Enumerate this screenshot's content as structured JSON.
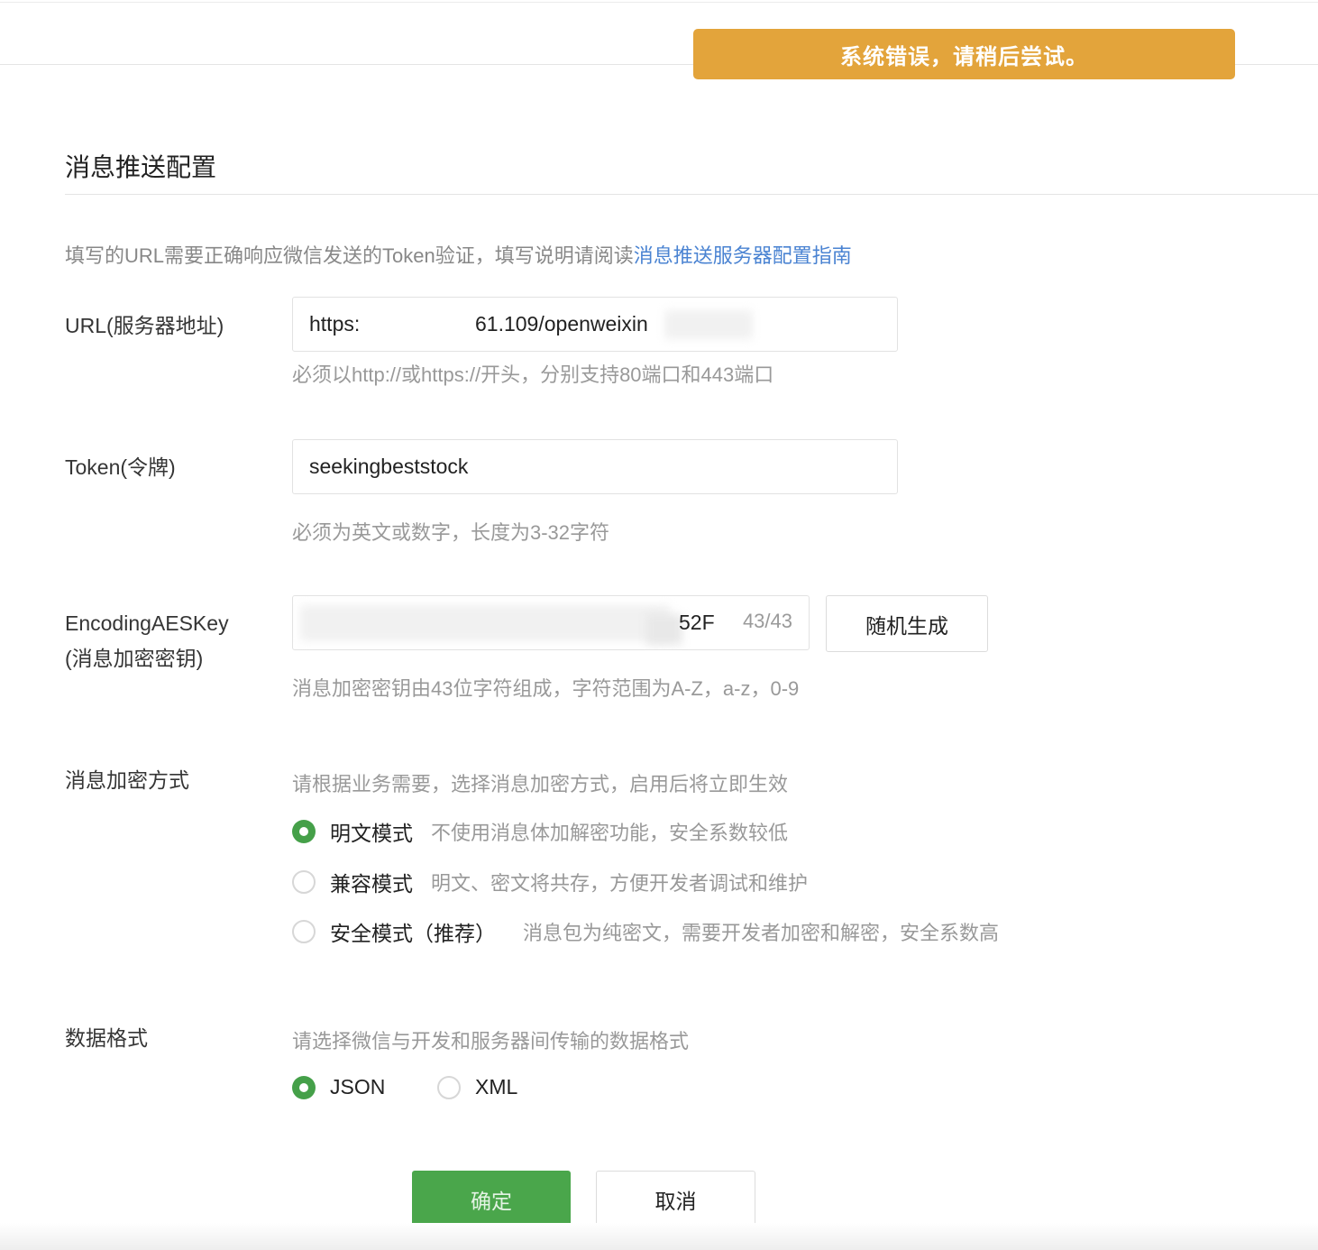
{
  "toast": {
    "message": "系统错误，请稍后尝试。",
    "color": "#e3a43b"
  },
  "section": {
    "title": "消息推送配置"
  },
  "intro": {
    "text": "填写的URL需要正确响应微信发送的Token验证，填写说明请阅读",
    "link": "消息推送服务器配置指南"
  },
  "url": {
    "label": "URL(服务器地址)",
    "value_start": "https:",
    "value_end": "61.109/openweixin",
    "hint": "必须以http://或https://开头，分别支持80端口和443端口"
  },
  "token": {
    "label": "Token(令牌)",
    "value": "seekingbeststock",
    "hint": "必须为英文或数字，长度为3-32字符"
  },
  "aes": {
    "label_line1": "EncodingAESKey",
    "label_line2": "(消息加密密钥)",
    "visible_tail": "52F",
    "counter": "43/43",
    "random_button": "随机生成",
    "hint": "消息加密密钥由43位字符组成，字符范围为A-Z，a-z，0-9"
  },
  "encrypt": {
    "label": "消息加密方式",
    "hint": "请根据业务需要，选择消息加密方式，启用后将立即生效",
    "options": [
      {
        "label": "明文模式",
        "desc": "不使用消息体加解密功能，安全系数较低",
        "checked": true
      },
      {
        "label": "兼容模式",
        "desc": "明文、密文将共存，方便开发者调试和维护",
        "checked": false
      },
      {
        "label": "安全模式（推荐）",
        "desc": "消息包为纯密文，需要开发者加密和解密，安全系数高",
        "checked": false
      }
    ]
  },
  "format": {
    "label": "数据格式",
    "hint": "请选择微信与开发和服务器间传输的数据格式",
    "options": [
      {
        "label": "JSON",
        "checked": true
      },
      {
        "label": "XML",
        "checked": false
      }
    ]
  },
  "actions": {
    "confirm": "确定",
    "cancel": "取消",
    "primary_color": "#4aa64b"
  }
}
